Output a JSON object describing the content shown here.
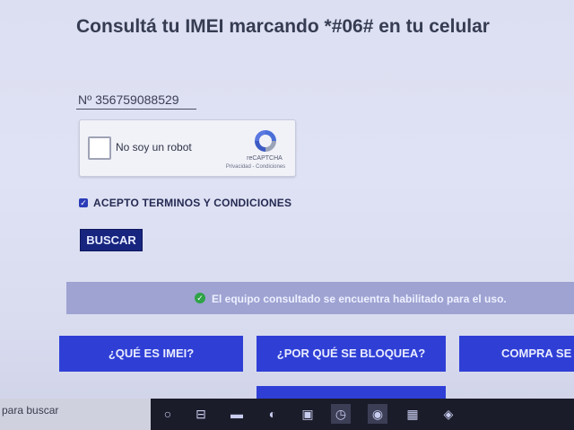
{
  "header": {
    "title": "Consultá tu IMEI marcando *#06# en tu celular"
  },
  "form": {
    "imei_value": "Nº  356759088529",
    "captcha": {
      "label": "No soy un robot",
      "brand": "reCAPTCHA",
      "links": "Privacidad - Condiciones"
    },
    "terms": {
      "label": "ACEPTO TERMINOS Y CONDICIONES",
      "checked": true
    },
    "search_button": "BUSCAR"
  },
  "status": {
    "message": "El equipo consultado se encuentra habilitado para el uso.",
    "color": "#2ea347"
  },
  "nav": {
    "what_is": "¿QUÉ ES IMEI?",
    "why_blocked": "¿POR QUÉ SE BLOQUEA?",
    "buy": "COMPRA SE"
  },
  "taskbar": {
    "search_placeholder": "para buscar",
    "icons": [
      "cortana-icon",
      "task-view-icon",
      "file-explorer-icon",
      "edge-icon",
      "excel-icon",
      "clock-app-icon",
      "chrome-icon",
      "calculator-icon",
      "vpn-icon"
    ]
  },
  "colors": {
    "accent": "#2f3fd6",
    "button_dark": "#17257e",
    "banner": "#9ea3d2"
  }
}
